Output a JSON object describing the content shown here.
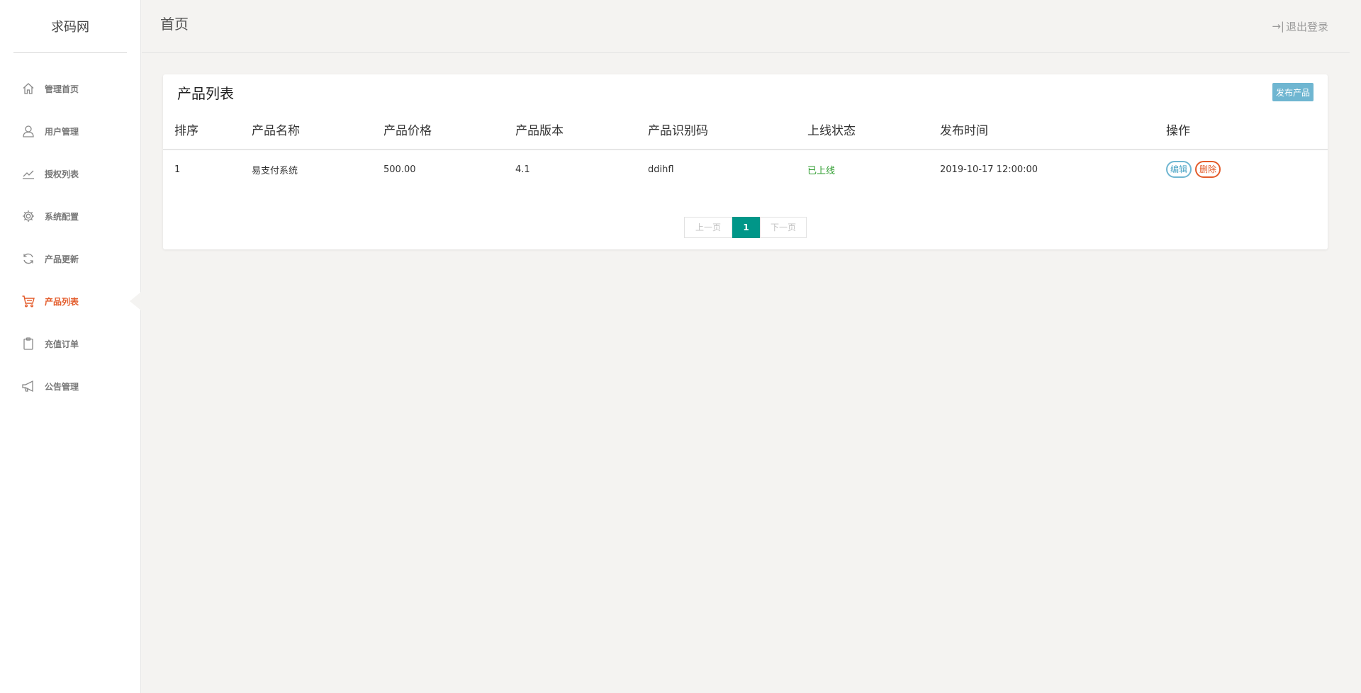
{
  "sidebar": {
    "brand": "求码网",
    "items": [
      {
        "label": "管理首页",
        "icon": "home-icon"
      },
      {
        "label": "用户管理",
        "icon": "user-icon"
      },
      {
        "label": "授权列表",
        "icon": "trend-icon"
      },
      {
        "label": "系统配置",
        "icon": "gear-icon"
      },
      {
        "label": "产品更新",
        "icon": "refresh-icon"
      },
      {
        "label": "产品列表",
        "icon": "cart-icon",
        "active": true
      },
      {
        "label": "充值订单",
        "icon": "clipboard-icon"
      },
      {
        "label": "公告管理",
        "icon": "megaphone-icon"
      }
    ]
  },
  "header": {
    "title": "首页",
    "logout_label": "退出登录",
    "logout_icon": "logout-icon"
  },
  "panel": {
    "title": "产品列表",
    "publish_label": "发布产品"
  },
  "table": {
    "columns": [
      "排序",
      "产品名称",
      "产品价格",
      "产品版本",
      "产品识别码",
      "上线状态",
      "发布时间",
      "操作"
    ],
    "rows": [
      {
        "order": "1",
        "name": "易支付系统",
        "price": "500.00",
        "version": "4.1",
        "code": "ddihfl",
        "status": "已上线",
        "time": "2019-10-17 12:00:00",
        "edit_label": "编辑",
        "delete_label": "删除"
      }
    ]
  },
  "pagination": {
    "prev_label": "上一页",
    "current": "1",
    "next_label": "下一页"
  },
  "colors": {
    "accent": "#e35b2a",
    "primary": "#009688",
    "info": "#6fb6d1",
    "success": "#2f9d2f"
  }
}
